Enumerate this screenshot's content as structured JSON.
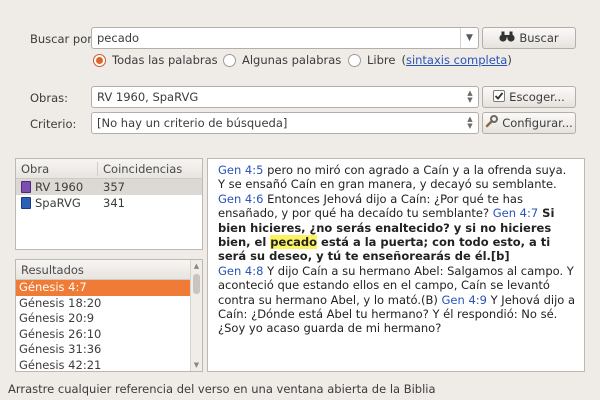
{
  "search": {
    "label": "Buscar por:",
    "value": "pecado",
    "button_label": "Buscar"
  },
  "options": {
    "radios": [
      {
        "label": "Todas las palabras",
        "selected": true
      },
      {
        "label": "Algunas palabras",
        "selected": false
      },
      {
        "label": "Libre",
        "selected": false
      }
    ],
    "syntax_link": "sintaxis completa"
  },
  "obras": {
    "label": "Obras:",
    "value": "RV 1960, SpaRVG",
    "button_label": "Escoger..."
  },
  "criterio": {
    "label": "Criterio:",
    "value": "[No hay un criterio de búsqueda]",
    "button_label": "Configurar..."
  },
  "works_table": {
    "headers": [
      "Obra",
      "Coincidencias"
    ],
    "rows": [
      {
        "name": "RV 1960",
        "count": "357",
        "icon": "bible-book-icon",
        "color": "#7a4fb0"
      },
      {
        "name": "SpaRVG",
        "count": "341",
        "icon": "bible-book-icon",
        "color": "#2b5fb8"
      }
    ]
  },
  "results": {
    "header": "Resultados",
    "items": [
      "Génesis 4:7",
      "Génesis 18:20",
      "Génesis 20:9",
      "Génesis 26:10",
      "Génesis 31:36",
      "Génesis 42:21"
    ],
    "selected_index": 0
  },
  "preview": {
    "v1_ref": "Gen 4:5",
    "v1_text": " pero no miró con agrado a Caín y a la ofrenda suya. Y se ensañó Caín en gran manera, y decayó su semblante. ",
    "v2_ref": "Gen 4:6",
    "v2_text": " Entonces Jehová dijo a Caín: ¿Por qué te has ensañado, y por qué ha decaído tu semblante? ",
    "v3_ref": "Gen 4:7",
    "v3_before": " Si bien hicieres, ¿no serás enaltecido? y si no hicieres bien, el ",
    "v3_highlight": "pecado",
    "v3_after": " está a la puerta; con todo esto, a ti será su deseo, y tú te enseñorearás de él.[b]",
    "v4_ref": "Gen 4:8",
    "v4_text": " Y dijo Caín a su hermano Abel: Salgamos al campo. Y aconteció que estando ellos en el campo, Caín se levantó contra su hermano Abel, y lo mató.(B) ",
    "v5_ref": "Gen 4:9",
    "v5_text": " Y Jehová dijo a Caín: ¿Dónde está Abel tu hermano? Y él respondió: No sé. ¿Soy yo acaso guarda de mi hermano?"
  },
  "status": {
    "text": "Arrastre cualquier referencia del verso en una ventana abierta de la Biblia"
  },
  "colors": {
    "accent": "#f07b37",
    "link": "#2a53b8",
    "highlight": "#fbf35f",
    "background": "#efebe7"
  }
}
